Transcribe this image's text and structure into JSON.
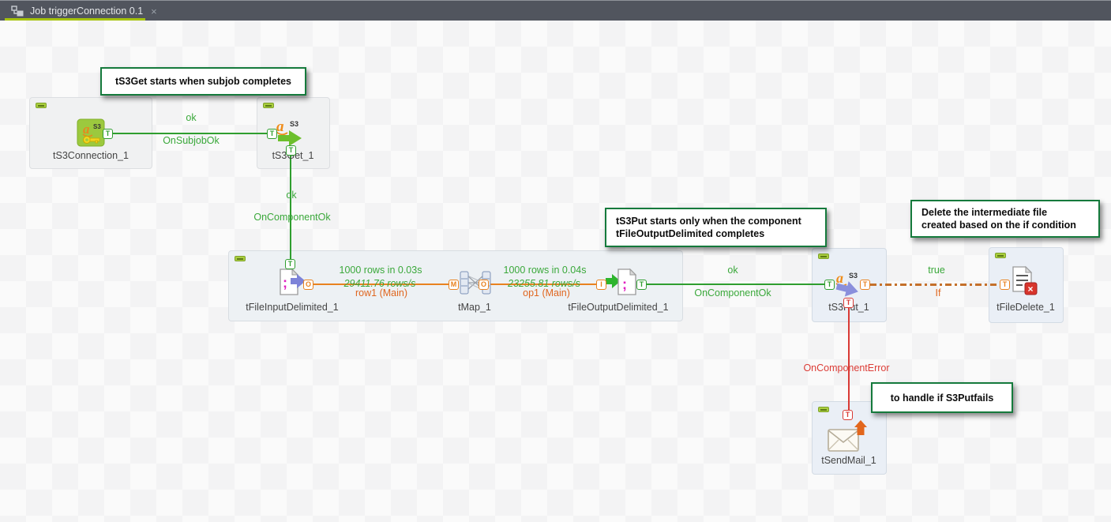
{
  "tab": {
    "title": "Job triggerConnection 0.1",
    "close": "×"
  },
  "components": {
    "s3connection": {
      "label": "tS3Connection_1"
    },
    "s3get": {
      "label": "tS3Get_1"
    },
    "fileinput": {
      "label": "tFileInputDelimited_1"
    },
    "tmap": {
      "label": "tMap_1"
    },
    "fileoutput": {
      "label": "tFileOutputDelimited_1"
    },
    "s3put": {
      "label": "tS3Put_1"
    },
    "filedelete": {
      "label": "tFileDelete_1"
    },
    "sendmail": {
      "label": "tSendMail_1"
    }
  },
  "links": {
    "subjob_ok": {
      "status": "ok",
      "type": "OnSubjobOk"
    },
    "component_ok_1": {
      "status": "ok",
      "type": "OnComponentOk"
    },
    "row1": {
      "rows": "1000 rows in 0.03s",
      "rate": "29411.76 rows/s",
      "name": "row1 (Main)"
    },
    "op1": {
      "rows": "1000 rows in 0.04s",
      "rate": "23255.81 rows/s",
      "name": "op1 (Main)"
    },
    "component_ok_2": {
      "status": "ok",
      "type": "OnComponentOk"
    },
    "if_link": {
      "status": "true",
      "type": "If"
    },
    "component_error": {
      "type": "OnComponentError"
    }
  },
  "callouts": {
    "c1": {
      "text": "tS3Get starts when subjob completes"
    },
    "c2": {
      "line1": "tS3Put starts only when the component",
      "line2": "tFileOutputDelimited  completes"
    },
    "c3": {
      "line1": "Delete the intermediate file",
      "line2": "created based on the if condition"
    },
    "c4": {
      "text": "to handle if S3Putfails"
    }
  },
  "anchors": {
    "trigger": "T",
    "output": "O",
    "map_in": "M",
    "input": "I"
  },
  "icons": {
    "amazon_a": "a",
    "s3_label": "S3",
    "delimiter": ";",
    "delete_x": "×"
  },
  "colors": {
    "trigger_green": "#2f9e2f",
    "flow_orange": "#e8821f",
    "if_dash_orange": "#c4702a",
    "error_red": "#d93a35",
    "note_border_green": "#157a3c",
    "tab_underline": "#a6c30d",
    "tabbar_bg": "#51555e"
  }
}
